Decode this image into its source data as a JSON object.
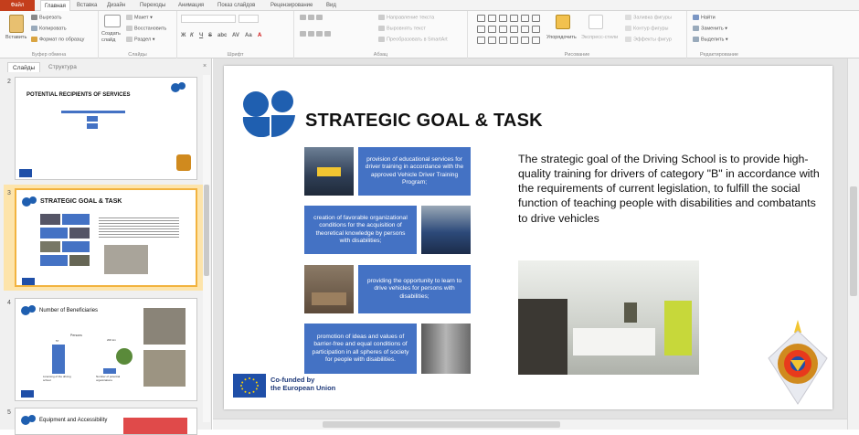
{
  "ribbon": {
    "file_tab": "Файл",
    "tabs": [
      "Главная",
      "Вставка",
      "Дизайн",
      "Переходы",
      "Анимация",
      "Показ слайдов",
      "Рецензирование",
      "Вид"
    ],
    "clipboard": {
      "paste": "Вставить",
      "cut": "Вырезать",
      "copy": "Копировать",
      "format_painter": "Формат по образцу",
      "group": "Буфер обмена"
    },
    "slides": {
      "new_slide": "Создать слайд",
      "layout": "Макет",
      "reset": "Восстановить",
      "section": "Раздел",
      "group": "Слайды"
    },
    "font": {
      "group": "Шрифт",
      "bold": "Ж",
      "italic": "К",
      "underline": "Ч",
      "strike": "S",
      "shadow": "abc",
      "spacing": "AV",
      "case": "Aa",
      "color": "A"
    },
    "paragraph": {
      "direction": "Направление текста",
      "align": "Выровнять текст",
      "smartart": "Преобразовать в SmartArt",
      "group": "Абзац"
    },
    "drawing": {
      "arrange": "Упорядочить",
      "quick_styles": "Экспресс-стили",
      "fill": "Заливка фигуры",
      "outline": "Контур фигуры",
      "effects": "Эффекты фигур",
      "group": "Рисование"
    },
    "editing": {
      "find": "Найти",
      "replace": "Заменить",
      "select": "Выделить",
      "group": "Редактирование"
    }
  },
  "panel": {
    "tab_slides": "Слайды",
    "tab_outline": "Структура",
    "close": "×",
    "slides": [
      {
        "number": "2",
        "title": "POTENTIAL RECIPIENTS OF SERVICES"
      },
      {
        "number": "3",
        "title": "STRATEGIC GOAL & TASK"
      },
      {
        "number": "4",
        "title": "Number of Beneficiaries",
        "chart_title": "Persons",
        "bar1_value": "57",
        "bar2_value": "200 km",
        "label1": "Licensing of the driving school",
        "label2": "Number of potential organizations"
      },
      {
        "number": "5",
        "title": "Equipment and Accessibility"
      }
    ]
  },
  "slide": {
    "title": "STRATEGIC GOAL  & TASK",
    "boxes": [
      "provision of educational services for driver training in accordance with the approved Vehicle Driver Training Program;",
      "creation of favorable organizational conditions for the acquisition of theoretical knowledge by persons with disabilities;",
      "providing the opportunity to learn to drive vehicles for persons with disabilities;",
      "promotion of ideas and values of barrier-free and equal conditions of participation in all spheres of society for people with disabilities."
    ],
    "goal": "The strategic goal of the Driving School is to provide high-quality training for drivers of category \"B\" in accordance with the requirements of current legislation, to fulfill the social function of teaching people with disabilities and combatants to drive vehicles",
    "eu_line1": "Co-funded by",
    "eu_line2": "the European Union"
  },
  "colors": {
    "accent_blue": "#4472c4",
    "logo_blue": "#1f5fb0",
    "file_tab": "#c43e1c",
    "selection": "#f2b33f"
  }
}
